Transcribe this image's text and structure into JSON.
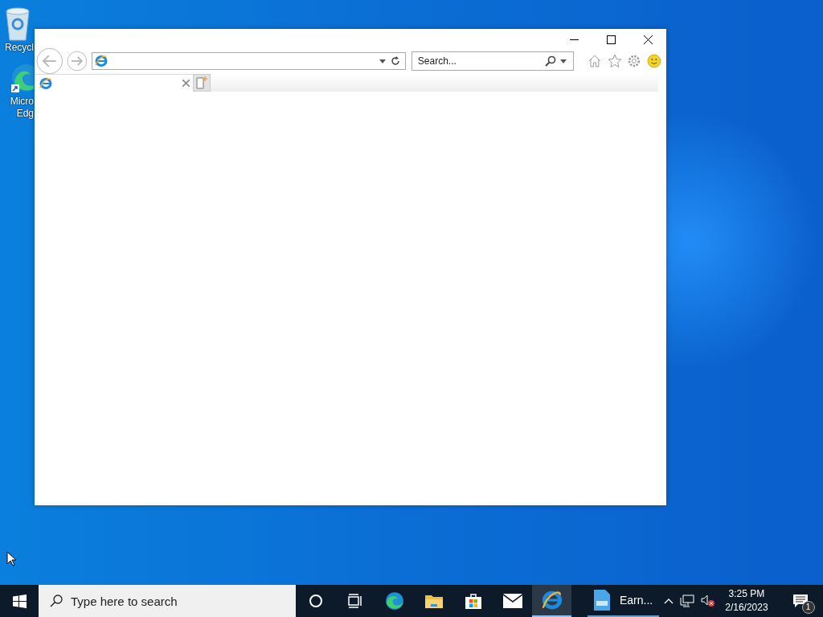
{
  "desktop": {
    "icons": [
      {
        "kind": "recycle-bin",
        "lines": [
          "Recycl"
        ]
      },
      {
        "kind": "edge",
        "lines": [
          "Micro",
          "Edg"
        ]
      }
    ]
  },
  "browser": {
    "search": {
      "placeholder": "Search..."
    },
    "tabs": [
      {
        "selected": true
      }
    ]
  },
  "taskbar": {
    "search": {
      "placeholder": "Type here to search"
    },
    "apps": [
      {
        "kind": "cortana",
        "selected": false
      },
      {
        "kind": "task-view",
        "selected": false
      },
      {
        "kind": "edge",
        "selected": false
      },
      {
        "kind": "folder",
        "selected": false
      },
      {
        "kind": "store",
        "selected": false
      },
      {
        "kind": "mail",
        "selected": false
      },
      {
        "kind": "ie",
        "selected": true
      }
    ],
    "window_button": {
      "label": "Earn..."
    },
    "clock": {
      "time": "3:25 PM",
      "date": "2/16/2023"
    },
    "notifications": {
      "count": "1"
    }
  }
}
